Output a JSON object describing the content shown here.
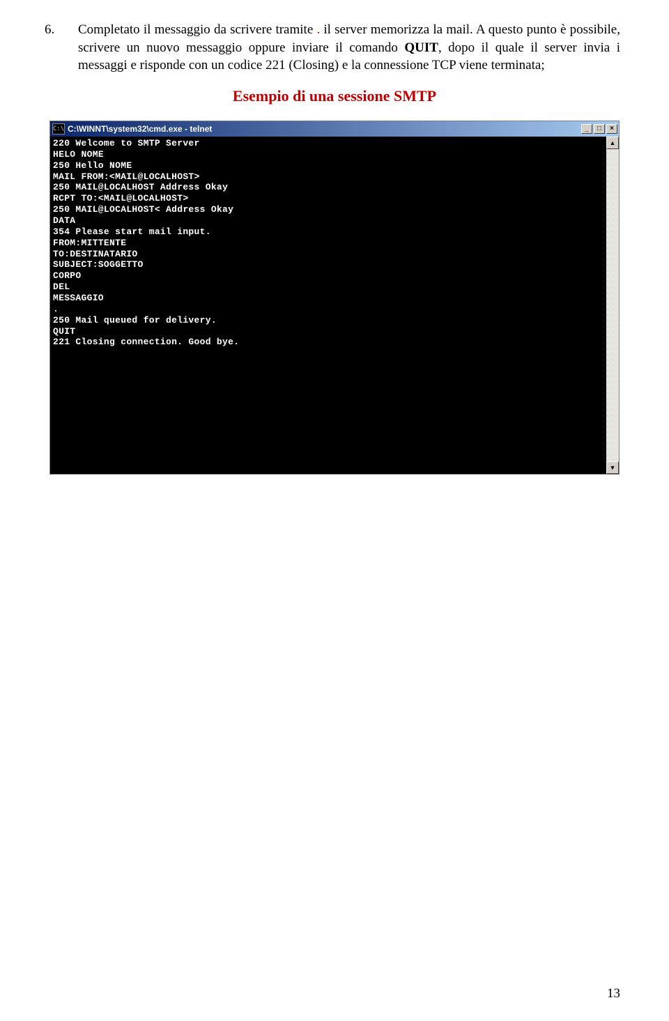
{
  "list_number": "6.",
  "paragraph": {
    "part1": "Completato il messaggio da scrivere tramite ",
    "dot": ".",
    "part2": " il server memorizza la mail. A questo punto è possibile, scrivere un nuovo messaggio oppure inviare il comando ",
    "bold": "QUIT",
    "part3": ", dopo il quale il server invia i messaggi e risponde con un codice 221 (Closing) e la connessione TCP viene terminata;"
  },
  "heading": "Esempio di una sessione SMTP",
  "window": {
    "icon_text": "C:\\",
    "title": "C:\\WINNT\\system32\\cmd.exe - telnet",
    "minimize": "_",
    "maximize": "□",
    "close": "×",
    "scroll_up": "▲",
    "scroll_down": "▼"
  },
  "terminal_lines": [
    "220 Welcome to SMTP Server",
    "HELO NOME",
    "250 Hello NOME",
    "MAIL FROM:<MAIL@LOCALHOST>",
    "250 MAIL@LOCALHOST Address Okay",
    "RCPT TO:<MAIL@LOCALHOST>",
    "250 MAIL@LOCALHOST< Address Okay",
    "DATA",
    "354 Please start mail input.",
    "FROM:MITTENTE",
    "TO:DESTINATARIO",
    "SUBJECT:SOGGETTO",
    "CORPO",
    "DEL",
    "MESSAGGIO",
    ".",
    "250 Mail queued for delivery.",
    "QUIT",
    "221 Closing connection. Good bye."
  ],
  "page_number": "13"
}
